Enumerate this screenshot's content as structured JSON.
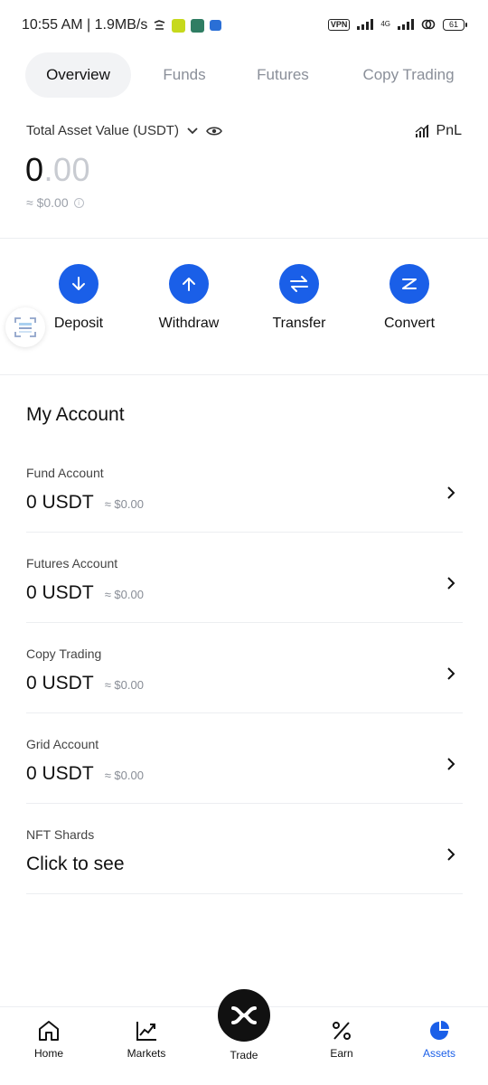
{
  "status_bar": {
    "time_speed": "10:55 AM | 1.9MB/s",
    "vpn": "VPN",
    "network": "4G",
    "battery": "61"
  },
  "tabs": [
    {
      "label": "Overview",
      "active": true
    },
    {
      "label": "Funds",
      "active": false
    },
    {
      "label": "Futures",
      "active": false
    },
    {
      "label": "Copy Trading",
      "active": false
    }
  ],
  "summary": {
    "label": "Total Asset Value (USDT)",
    "pnl_label": "PnL",
    "value_int": "0",
    "value_dec": ".00",
    "approx": "≈ $0.00"
  },
  "actions": [
    {
      "label": "Deposit",
      "icon": "arrow-down-icon"
    },
    {
      "label": "Withdraw",
      "icon": "arrow-up-icon"
    },
    {
      "label": "Transfer",
      "icon": "transfer-icon"
    },
    {
      "label": "Convert",
      "icon": "convert-icon"
    }
  ],
  "my_account": {
    "title": "My Account",
    "items": [
      {
        "name": "Fund Account",
        "amount": "0 USDT",
        "usd": "≈ $0.00"
      },
      {
        "name": "Futures Account",
        "amount": "0 USDT",
        "usd": "≈ $0.00"
      },
      {
        "name": "Copy Trading",
        "amount": "0 USDT",
        "usd": "≈ $0.00"
      },
      {
        "name": "Grid Account",
        "amount": "0 USDT",
        "usd": "≈ $0.00"
      },
      {
        "name": "NFT Shards",
        "cta": "Click to see"
      }
    ]
  },
  "bottom_nav": [
    {
      "label": "Home",
      "icon": "home-icon",
      "active": false
    },
    {
      "label": "Markets",
      "icon": "markets-chart-icon",
      "active": false
    },
    {
      "label": "Trade",
      "icon": "trade-logo-icon",
      "active": false
    },
    {
      "label": "Earn",
      "icon": "percent-icon",
      "active": false
    },
    {
      "label": "Assets",
      "icon": "pie-chart-icon",
      "active": true
    }
  ],
  "colors": {
    "accent": "#1a5fe8",
    "muted": "#8a8f99"
  }
}
